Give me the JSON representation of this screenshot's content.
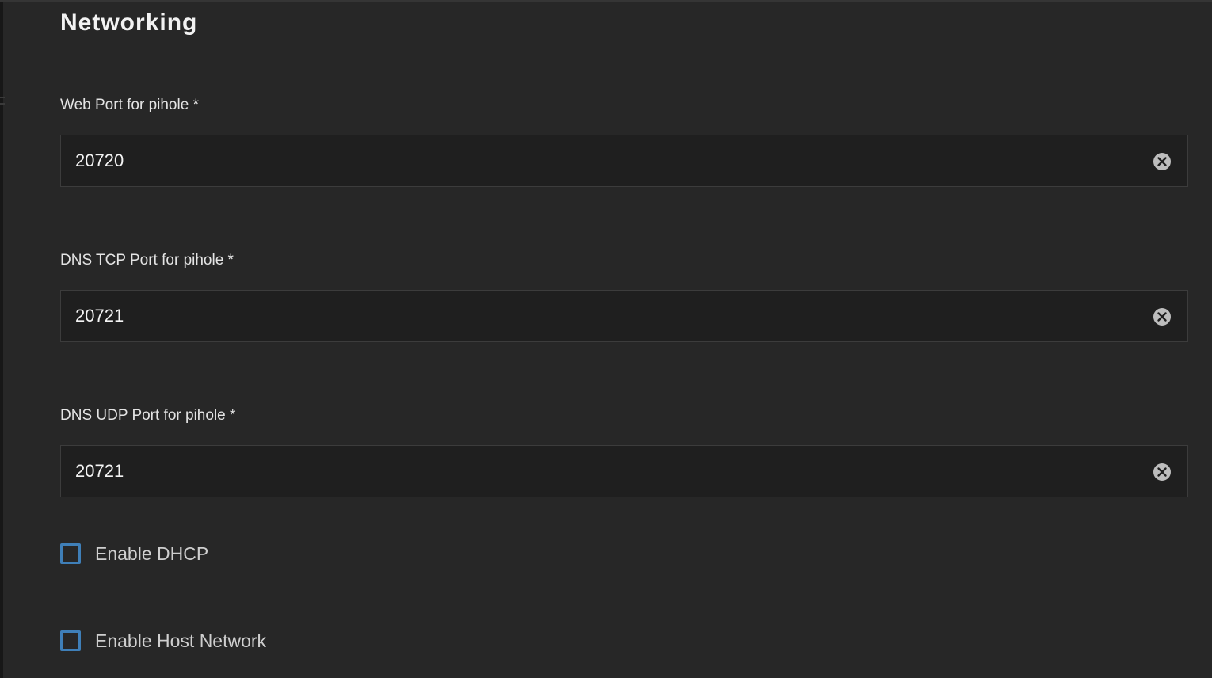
{
  "section": {
    "title": "Networking"
  },
  "fields": [
    {
      "label": "Web Port for pihole *",
      "value": "20720",
      "clear_icon": "clear-circle-icon"
    },
    {
      "label": "DNS TCP Port for pihole *",
      "value": "20721",
      "clear_icon": "clear-circle-icon"
    },
    {
      "label": "DNS UDP Port for pihole *",
      "value": "20721",
      "clear_icon": "clear-circle-icon"
    }
  ],
  "checkboxes": [
    {
      "label": "Enable DHCP",
      "checked": false
    },
    {
      "label": "Enable Host Network",
      "checked": false
    }
  ],
  "colors": {
    "background": "#272727",
    "input_background": "#1f1f1f",
    "checkbox_accent": "#3f7fb8",
    "text": "#f2f2f2"
  }
}
